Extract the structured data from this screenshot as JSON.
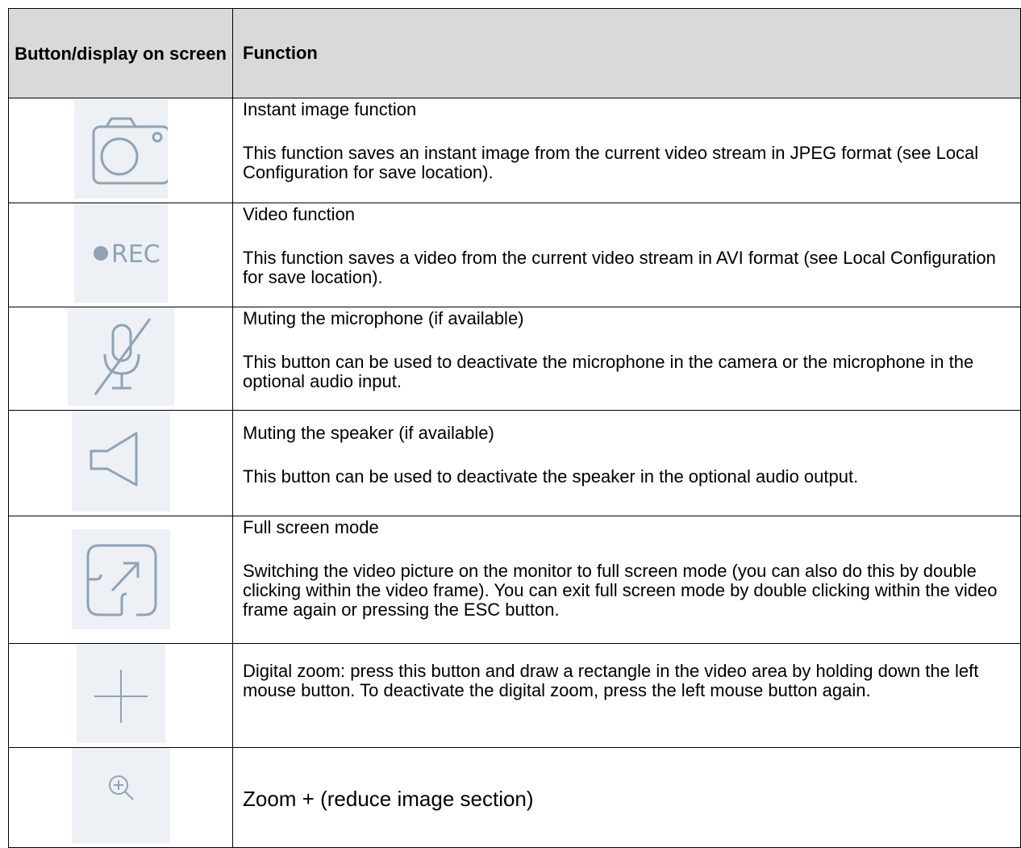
{
  "header": {
    "col1": "Button/display on screen",
    "col2": "Function"
  },
  "rows": [
    {
      "icon": "camera-icon",
      "title": "Instant image function",
      "desc": "This function saves an instant image from the current video stream in JPEG format (see Local Configuration for save location)."
    },
    {
      "icon": "record-icon",
      "icon_text": "REC",
      "title": "Video function",
      "desc": "This function saves a video from the current video stream in AVI format (see Local Configuration for save location)."
    },
    {
      "icon": "microphone-muted-icon",
      "title": "Muting the microphone (if available)",
      "desc": "This button can be used to deactivate the microphone in the camera or the microphone in the optional audio input."
    },
    {
      "icon": "speaker-icon",
      "title": "Muting the speaker (if available)",
      "desc": "This button can be used to deactivate the speaker in the optional audio output."
    },
    {
      "icon": "fullscreen-icon",
      "title": "Full screen mode",
      "desc": "Switching the video picture on the monitor to full screen mode (you can also do this by double clicking within the video frame). You can exit full screen mode by double clicking within the video frame again or pressing the ESC button."
    },
    {
      "icon": "crosshair-icon",
      "desc": "Digital zoom: press this button and draw a rectangle in the video area by holding down the left mouse button. To deactivate the digital zoom, press the left mouse button again."
    },
    {
      "icon": "zoom-in-icon",
      "desc": "Zoom + (reduce image section)"
    }
  ],
  "colors": {
    "header_bg": "#d9d9d9",
    "icon_bg": "#edf0f4",
    "icon_stroke": "#8fa3b5"
  }
}
